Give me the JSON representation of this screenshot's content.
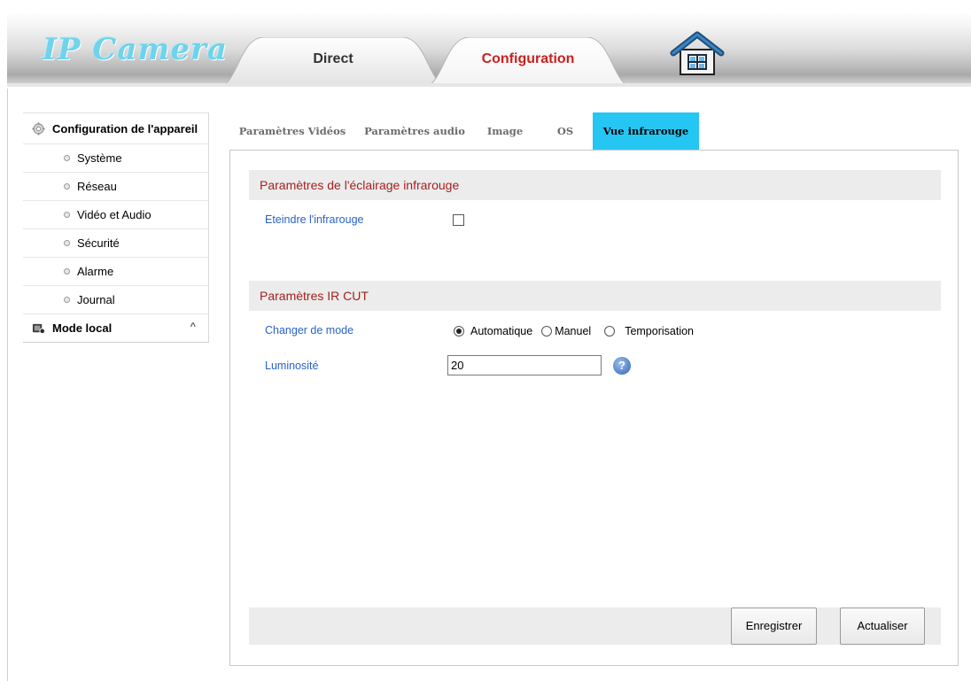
{
  "header": {
    "logo_text": "IP Camera",
    "tabs": [
      {
        "label": "Direct",
        "active": false
      },
      {
        "label": "Configuration",
        "active": true
      }
    ],
    "home_icon": "home-icon"
  },
  "sidebar": {
    "device_config_label": "Configuration de l'appareil",
    "items": [
      {
        "label": "Système"
      },
      {
        "label": "Réseau"
      },
      {
        "label": "Vidéo et Audio"
      },
      {
        "label": "Sécurité"
      },
      {
        "label": "Alarme"
      },
      {
        "label": "Journal"
      }
    ],
    "local_mode_label": "Mode local",
    "local_mode_chevron": "^"
  },
  "subtabs": [
    {
      "label": "Paramètres Vidéos",
      "active": false
    },
    {
      "label": "Paramètres audio",
      "active": false
    },
    {
      "label": "Image",
      "active": false
    },
    {
      "label": "OS",
      "active": false
    },
    {
      "label": "Vue infrarouge",
      "active": true
    }
  ],
  "ir_lighting": {
    "section_title": "Paramètres de l'éclairage infrarouge",
    "turn_off_label": "Eteindre l'infrarouge",
    "turn_off_checked": false
  },
  "ir_cut": {
    "section_title": "Paramètres IR CUT",
    "mode_label": "Changer de mode",
    "modes": [
      {
        "label": "Automatique",
        "selected": true
      },
      {
        "label": "Manuel",
        "selected": false
      },
      {
        "label": "Temporisation",
        "selected": false
      }
    ],
    "brightness_label": "Luminosité",
    "brightness_value": "20",
    "help_icon": "?"
  },
  "actions": {
    "save_label": "Enregistrer",
    "refresh_label": "Actualiser"
  },
  "colors": {
    "active_subtab": "#26c6f2",
    "section_title": "#a32121",
    "field_label": "#2a62c9",
    "config_tab_text": "#cc1f1f"
  }
}
